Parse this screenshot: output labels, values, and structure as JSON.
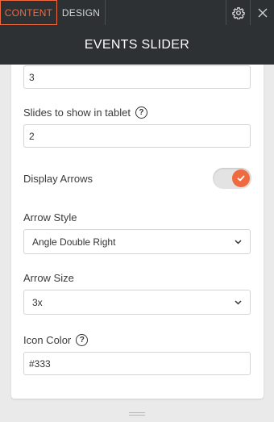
{
  "tabs": {
    "content_label": "CONTENT",
    "design_label": "DESIGN",
    "settings_icon": "gear-icon",
    "close_icon": "close-icon"
  },
  "header": {
    "title": "EVENTS SLIDER"
  },
  "form": {
    "slides_desktop_value": "3",
    "slides_tablet_label": "Slides to show in tablet",
    "slides_tablet_value": "2",
    "display_arrows_label": "Display Arrows",
    "display_arrows_on": true,
    "arrow_style_label": "Arrow Style",
    "arrow_style_value": "Angle Double Right",
    "arrow_size_label": "Arrow Size",
    "arrow_size_value": "3x",
    "icon_color_label": "Icon Color",
    "icon_color_value": "#333"
  },
  "help_glyph": "?",
  "colors": {
    "accent": "#ef6a3f",
    "topbar": "#2d3134"
  }
}
